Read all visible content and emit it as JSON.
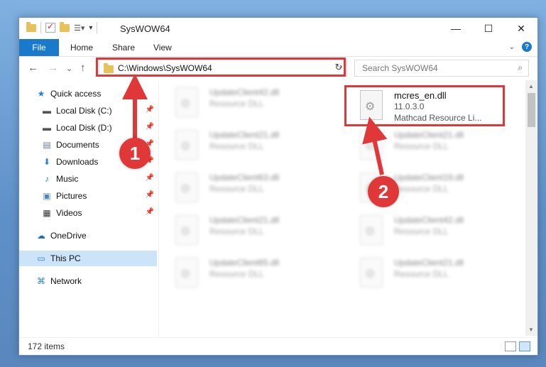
{
  "window": {
    "title": "SysWOW64",
    "controls": {
      "minimize": "—",
      "maximize": "☐",
      "close": "✕"
    }
  },
  "ribbon": {
    "tabs": [
      "File",
      "Home",
      "Share",
      "View"
    ],
    "help": "?"
  },
  "nav": {
    "back": "←",
    "forward": "→",
    "recent": "⌄",
    "up": "↑",
    "address": "C:\\Windows\\SysWOW64",
    "search_placeholder": "Search SysWOW64"
  },
  "sidebar": {
    "items": [
      {
        "label": "Quick access",
        "icon": "star-icon"
      },
      {
        "label": "Local Disk (C:)",
        "icon": "drive-icon"
      },
      {
        "label": "Local Disk (D:)",
        "icon": "drive-icon"
      },
      {
        "label": "Documents",
        "icon": "document-icon"
      },
      {
        "label": "Downloads",
        "icon": "download-icon"
      },
      {
        "label": "Music",
        "icon": "music-icon"
      },
      {
        "label": "Pictures",
        "icon": "pictures-icon"
      },
      {
        "label": "Videos",
        "icon": "video-icon"
      },
      {
        "label": "OneDrive",
        "icon": "cloud-icon"
      },
      {
        "label": "This PC",
        "icon": "computer-icon"
      },
      {
        "label": "Network",
        "icon": "network-icon"
      }
    ]
  },
  "files": {
    "highlighted": {
      "name": "mcres_en.dll",
      "version": "11.0.3.0",
      "description": "Mathcad Resource Li..."
    },
    "left_column": [
      {
        "name": "UpdateClient42.dll",
        "type": "Resource DLL"
      },
      {
        "name": "UpdateClient21.dll",
        "type": "Resource DLL"
      },
      {
        "name": "UpdateClient63.dll",
        "type": "Resource DLL"
      },
      {
        "name": "UpdateClient21.dll",
        "type": "Resource DLL"
      },
      {
        "name": "UpdateClient65.dll",
        "type": "Resource DLL"
      }
    ],
    "right_column": [
      {
        "name": "UpdateClient21.dll",
        "type": "Resource DLL"
      },
      {
        "name": "UpdateClient19.dll",
        "type": "Resource DLL"
      },
      {
        "name": "UpdateClient42.dll",
        "type": "Resource DLL"
      },
      {
        "name": "UpdateClient21.dll",
        "type": "Resource DLL"
      }
    ]
  },
  "status": {
    "item_count": "172 items"
  },
  "annotations": {
    "step1": "1",
    "step2": "2",
    "color": "#e03838"
  }
}
